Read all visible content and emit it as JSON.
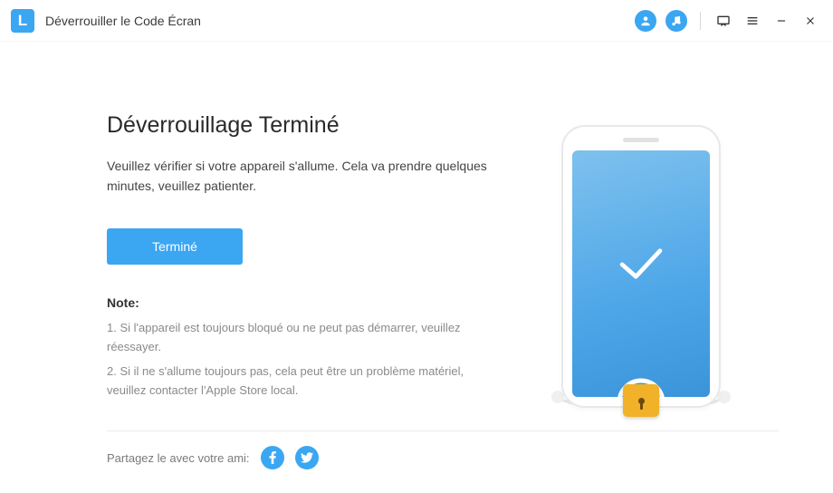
{
  "titlebar": {
    "title": "Déverrouiller le Code Écran"
  },
  "main": {
    "heading": "Déverrouillage Terminé",
    "subtext": "Veuillez vérifier si votre appareil s'allume. Cela va prendre quelques minutes, veuillez patienter.",
    "done_label": "Terminé",
    "note_title": "Note:",
    "notes": [
      "1. Si l'appareil est toujours bloqué ou ne peut pas démarrer, veuillez réessayer.",
      "2. Si il ne s'allume toujours pas, cela peut être un problème matériel, veuillez contacter l'Apple Store local."
    ]
  },
  "footer": {
    "share_label": "Partagez le avec votre ami:"
  }
}
